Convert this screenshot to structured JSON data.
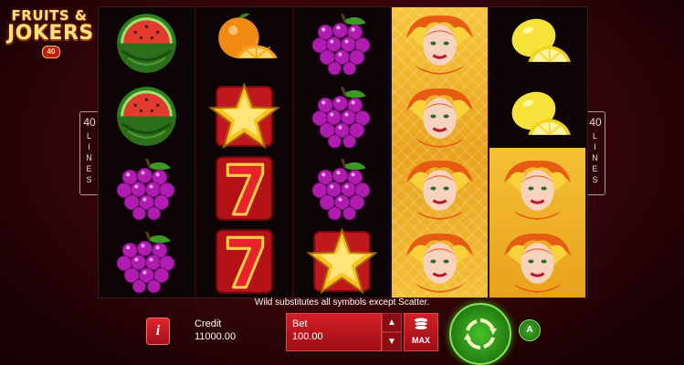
{
  "logo": {
    "line1": "FRUITS &",
    "line2": "JOKERS",
    "badge": "40"
  },
  "lines": {
    "number": "40",
    "word": "LINES"
  },
  "reels": [
    [
      "watermelon-icon",
      "watermelon-icon",
      "grapes-icon",
      "grapes-icon"
    ],
    [
      "orange-icon",
      "star-icon",
      "seven-icon",
      "seven-icon"
    ],
    [
      "grapes-icon",
      "grapes-icon",
      "grapes-icon",
      "star-icon"
    ],
    [
      "joker-icon",
      "joker-icon",
      "joker-icon",
      "joker-icon"
    ],
    [
      "lemon-icon",
      "lemon-icon",
      "joker-icon",
      "joker-icon"
    ]
  ],
  "info_text": "Wild substitutes all symbols except Scatter.",
  "credit": {
    "label": "Credit",
    "value": "11000.00"
  },
  "bet": {
    "label": "Bet",
    "value": "100.00"
  },
  "max_label": "MAX",
  "info_button": "i",
  "auto_label": "A",
  "colors": {
    "accent_red": "#c0181d",
    "gold": "#f4bf36",
    "spin_green": "#47c12a"
  }
}
